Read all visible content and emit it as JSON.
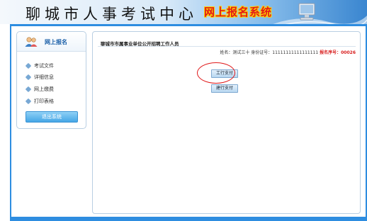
{
  "header": {
    "site_title": "聊城市人事考试中心",
    "brand_title": "网上报名系统"
  },
  "sidebar": {
    "title": "网上报名",
    "items": [
      {
        "label": "考试文件"
      },
      {
        "label": "详细信息"
      },
      {
        "label": "网上缴费"
      },
      {
        "label": "打印表格"
      }
    ],
    "exit_label": "退出系统"
  },
  "content": {
    "title": "聊城市市属事业单位公开招聘工作人员",
    "info": {
      "name_label": "姓名：",
      "name_value": "测试三十",
      "id_label": "身份证号：",
      "id_value": "11111111111111111",
      "serial_label": "报名序号：",
      "serial_value": "00026"
    },
    "buttons": {
      "icbc_pay": "工行支付",
      "ccb_pay": "建行支付"
    }
  },
  "colors": {
    "frame_blue": "#2e8de0",
    "title_text": "#1a5fa8",
    "serial_red": "#d81e1e",
    "highlight_red": "#e0191a"
  }
}
